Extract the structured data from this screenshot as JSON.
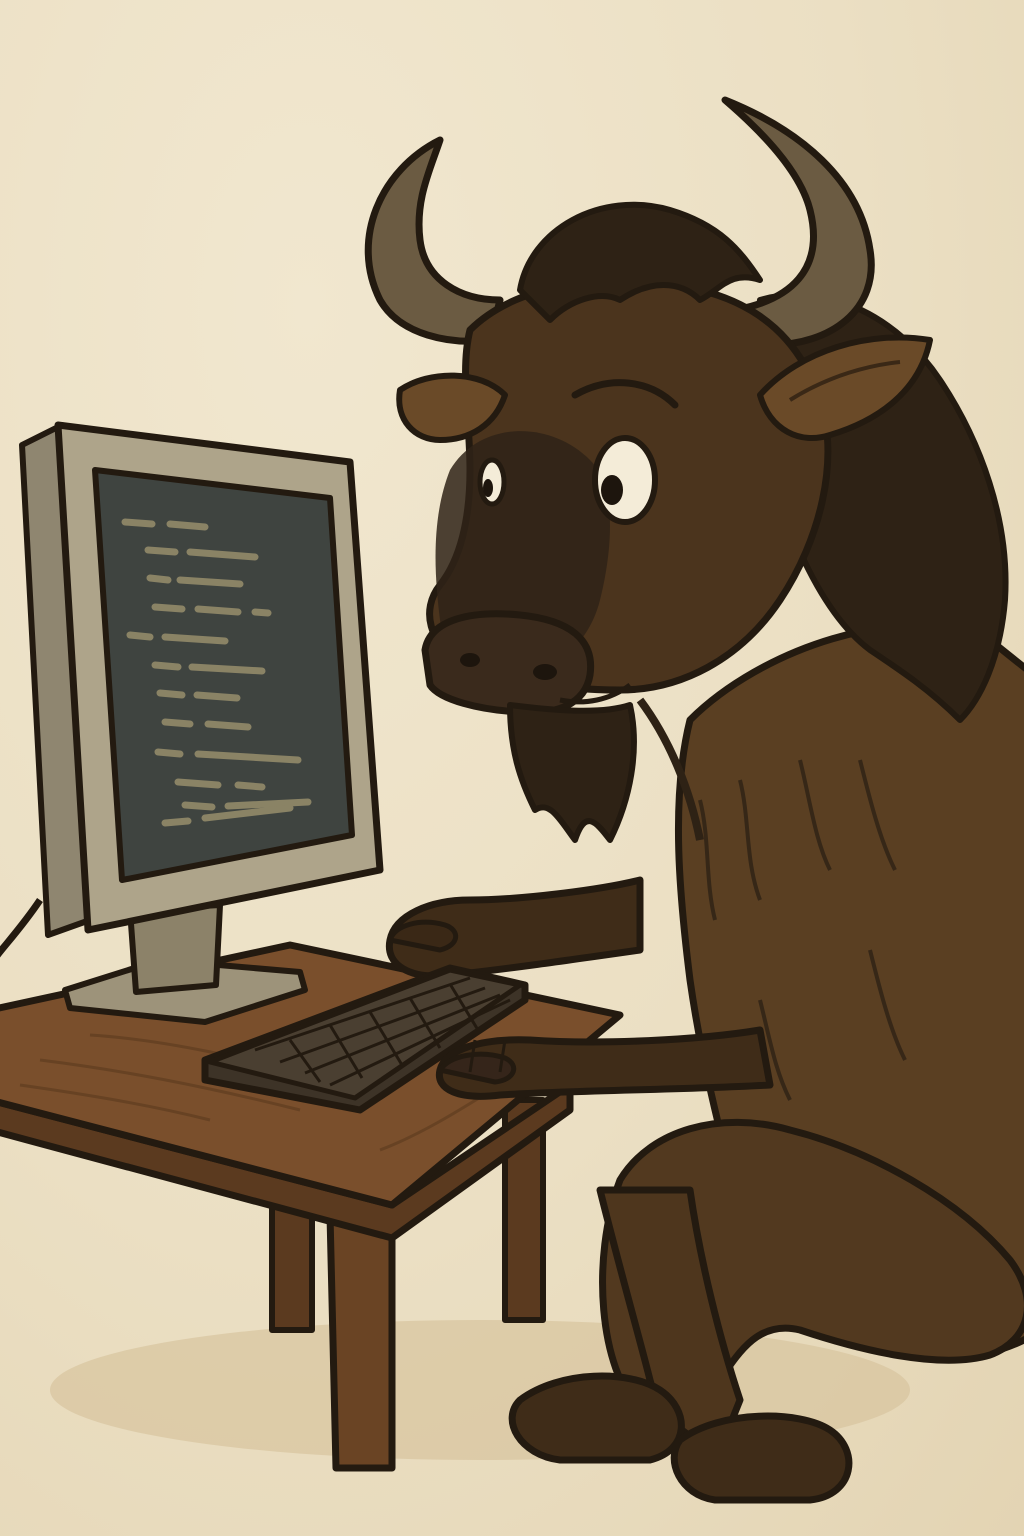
{
  "illustration": {
    "subject": "gnu-icon",
    "style": "hand-drawn cartoon",
    "palette": {
      "background": "#ece0c4",
      "outline": "#231a10",
      "fur": "#5a3f22",
      "fur_dark": "#3f2c18",
      "mane": "#2e2215",
      "horn": "#6b5b42",
      "desk": "#7a4f2c",
      "desk_dark": "#5b3a1f",
      "monitor_casing": "#aea48a",
      "screen": "#3f4440",
      "code_lines": "#8a8365",
      "keyboard": "#4a3f31"
    },
    "screen_code_lines": 13
  }
}
